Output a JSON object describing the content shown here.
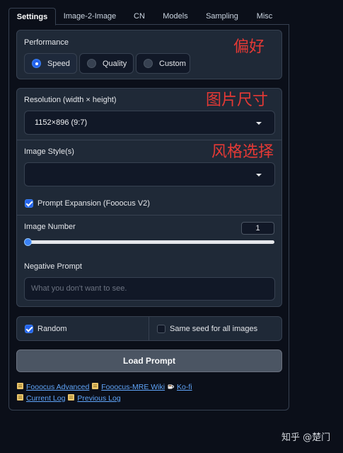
{
  "tabs": [
    "Settings",
    "Image-2-Image",
    "CN",
    "Models",
    "Sampling",
    "Misc"
  ],
  "active_tab": "Settings",
  "performance": {
    "label": "Performance",
    "options": [
      "Speed",
      "Quality",
      "Custom"
    ],
    "selected": "Speed"
  },
  "resolution": {
    "label": "Resolution (width × height)",
    "value": "1152×896 (9:7)"
  },
  "image_style": {
    "label": "Image Style(s)",
    "value": ""
  },
  "prompt_expansion": {
    "label": "Prompt Expansion (Fooocus V2)",
    "checked": true
  },
  "image_number": {
    "label": "Image Number",
    "value": "1",
    "slider_fraction": 0.0
  },
  "negative_prompt": {
    "label": "Negative Prompt",
    "placeholder": "What you don't want to see."
  },
  "seed": {
    "random_label": "Random",
    "random_checked": true,
    "same_seed_label": "Same seed for all images",
    "same_seed_checked": false
  },
  "load_prompt_label": "Load Prompt",
  "links": {
    "fooocus_advanced": "Fooocus Advanced",
    "mre_wiki": "Fooocus-MRE Wiki",
    "ko_fi": "Ko-fi",
    "current_log": "Current Log",
    "previous_log": "Previous Log"
  },
  "annotations": {
    "preference": "偏好",
    "image_size": "图片尺寸",
    "style_choice": "风格选择"
  },
  "watermark": "知乎 @楚门",
  "colors": {
    "background": "#0b0f19",
    "panel": "#1f2937",
    "accent": "#2563eb",
    "annotation_red": "#e53935",
    "link": "#60a5fa"
  }
}
